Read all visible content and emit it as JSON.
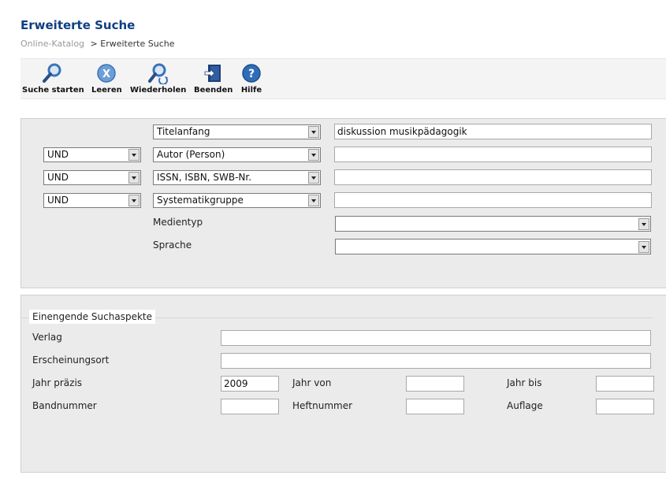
{
  "page": {
    "title": "Erweiterte Suche",
    "breadcrumb": {
      "root": "Online-Katalog",
      "separator": ">",
      "current": "Erweiterte Suche"
    }
  },
  "toolbar": [
    {
      "label": "Suche starten",
      "icon": "search-icon"
    },
    {
      "label": "Leeren",
      "icon": "clear-icon"
    },
    {
      "label": "Wiederholen",
      "icon": "repeat-search-icon"
    },
    {
      "label": "Beenden",
      "icon": "exit-icon"
    },
    {
      "label": "Hilfe",
      "icon": "help-icon"
    }
  ],
  "search": {
    "rows": [
      {
        "operator": "",
        "field": "Titelanfang",
        "value": "diskussion musikpädagogik"
      },
      {
        "operator": "UND",
        "field": "Autor (Person)",
        "value": ""
      },
      {
        "operator": "UND",
        "field": "ISSN, ISBN, SWB-Nr.",
        "value": ""
      },
      {
        "operator": "UND",
        "field": "Systematikgruppe",
        "value": ""
      }
    ],
    "medientyp_label": "Medientyp",
    "medientyp_value": "",
    "sprache_label": "Sprache",
    "sprache_value": ""
  },
  "refine": {
    "legend": "Einengende Suchaspekte",
    "verlag_label": "Verlag",
    "verlag_value": "",
    "ort_label": "Erscheinungsort",
    "ort_value": "",
    "jahr_praezis_label": "Jahr präzis",
    "jahr_praezis_value": "2009",
    "jahr_von_label": "Jahr von",
    "jahr_von_value": "",
    "jahr_bis_label": "Jahr bis",
    "jahr_bis_value": "",
    "bandnummer_label": "Bandnummer",
    "bandnummer_value": "",
    "heftnummer_label": "Heftnummer",
    "heftnummer_value": "",
    "auflage_label": "Auflage",
    "auflage_value": ""
  },
  "colors": {
    "title": "#0f3f82",
    "panel": "#ebebeb",
    "icon": "#3a73b8"
  }
}
